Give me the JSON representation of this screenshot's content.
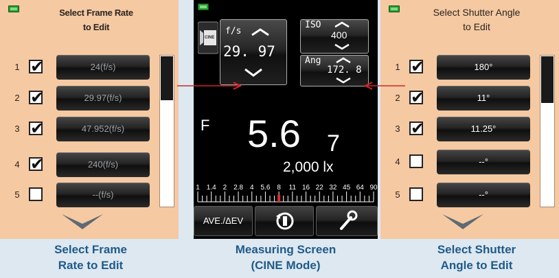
{
  "frame_rate_panel": {
    "title_line1": "Select Frame Rate",
    "title_line2": "to Edit",
    "rows": [
      {
        "num": "1",
        "checked": true,
        "value": "24(f/s)"
      },
      {
        "num": "2",
        "checked": true,
        "value": "29.97(f/s)"
      },
      {
        "num": "3",
        "checked": true,
        "value": "47.952(f/s)"
      },
      {
        "num": "4",
        "checked": true,
        "value": "240(f/s)"
      },
      {
        "num": "5",
        "checked": false,
        "value": "--(f/s)"
      }
    ],
    "caption_line1": "Select Frame",
    "caption_line2": "Rate to Edit"
  },
  "measuring_screen": {
    "cine_icon_label": "CINE",
    "fs_label": "f/s",
    "fs_value": "29. 97",
    "iso_label": "ISO",
    "iso_value": "400",
    "ang_label": "Ang",
    "ang_value": "172. 8",
    "f_label": "F",
    "f_main": "5.6",
    "f_sub": "7",
    "lux_value": "2,000 lx",
    "scale_ticks": [
      "1",
      "1.4",
      "2",
      "2.8",
      "4",
      "5.6",
      "8",
      "11",
      "16",
      "22",
      "32",
      "45",
      "64",
      "90"
    ],
    "pointer_value": "8",
    "ave_button": "AVE./ΔEV",
    "caption_line1": "Measuring Screen",
    "caption_line2": "(CINE Mode)"
  },
  "shutter_angle_panel": {
    "title_line1": "Select Shutter Angle",
    "title_line2": "to Edit",
    "rows": [
      {
        "num": "1",
        "checked": true,
        "value": "180°"
      },
      {
        "num": "2",
        "checked": true,
        "value": "11°"
      },
      {
        "num": "3",
        "checked": true,
        "value": "11.25°"
      },
      {
        "num": "4",
        "checked": false,
        "value": "--°"
      },
      {
        "num": "5",
        "checked": false,
        "value": "--°"
      }
    ],
    "caption_line1": "Select Shutter",
    "caption_line2": "Angle to Edit"
  },
  "colors": {
    "panel_bg": "#f5c9a2",
    "caption": "#1f5a88",
    "arrow": "#d1262a",
    "battery": "#2f9a35"
  }
}
